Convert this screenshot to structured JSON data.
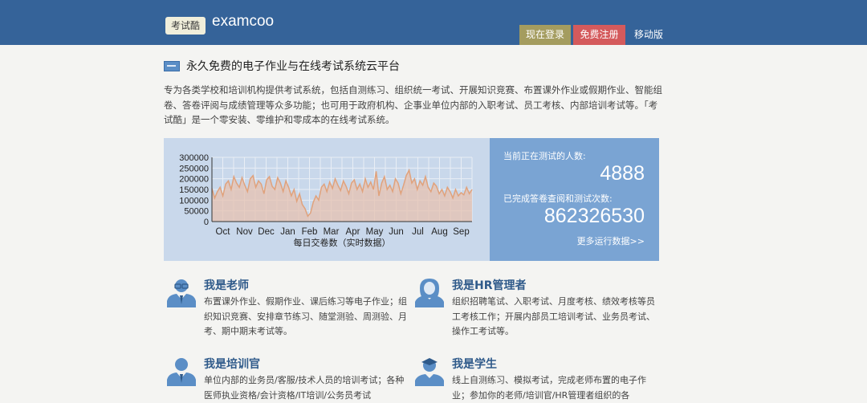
{
  "header": {
    "logo_text": "考试酷",
    "brand": "examcoo",
    "login": "现在登录",
    "register": "免费注册",
    "mobile": "移动版",
    "colors": {
      "bar": "#356399",
      "login": "#a49c5f",
      "register": "#d45a5c"
    }
  },
  "intro": {
    "tagline": "永久免费的电子作业与在线考试系统云平台",
    "text": "专为各类学校和培训机构提供考试系统，包括自测练习、组织统一考试、开展知识竞赛、布置课外作业或假期作业、智能组卷、答卷评阅与成绩管理等众多功能；也可用于政府机构、企事业单位内部的入职考试、员工考核、内部培训考试等。「考试酷」是一个零安装、零维护和零成本的在线考试系统。"
  },
  "stats": {
    "testing_label": "当前正在测试的人数:",
    "testing_value": "4888",
    "completed_label": "已完成答卷查阅和测试次数:",
    "completed_value": "862326530",
    "more_link": "更多运行数据>>"
  },
  "chart_data": {
    "type": "area",
    "title": "",
    "xlabel": "每日交卷数（实时数据）",
    "ylabel": "",
    "ylim": [
      0,
      300000
    ],
    "yticks": [
      0,
      50000,
      100000,
      150000,
      200000,
      250000,
      300000
    ],
    "categories": [
      "Oct",
      "Nov",
      "Dec",
      "Jan",
      "Feb",
      "Mar",
      "Apr",
      "May",
      "Jun",
      "Jul",
      "Aug",
      "Sep"
    ],
    "colors": {
      "line": "#e0a27c",
      "fill": "#e5c2b0"
    },
    "series": [
      {
        "values": [
          155000,
          110000,
          140000,
          160000,
          120000,
          175000,
          190000,
          150000,
          210000,
          180000,
          160000,
          205000,
          170000,
          140000,
          200000,
          215000,
          160000,
          190000,
          175000,
          130000,
          195000,
          210000,
          165000,
          150000,
          205000,
          180000,
          140000,
          190000,
          160000,
          120000,
          150000,
          95000,
          130000,
          80000,
          60000,
          25000,
          40000,
          90000,
          120000,
          100000,
          160000,
          175000,
          140000,
          185000,
          155000,
          200000,
          170000,
          145000,
          190000,
          165000,
          130000,
          180000,
          195000,
          150000,
          175000,
          140000,
          200000,
          160000,
          185000,
          150000,
          235000,
          120000,
          180000,
          210000,
          150000,
          170000,
          140000,
          200000,
          180000,
          130000,
          170000,
          215000,
          240000,
          180000,
          200000,
          150000,
          190000,
          170000,
          210000,
          160000,
          140000,
          180000,
          165000,
          130000,
          150000,
          120000,
          160000,
          140000,
          110000,
          150000,
          120000,
          135000,
          125000,
          160000,
          130000,
          150000
        ]
      }
    ]
  },
  "roles": [
    {
      "title": "我是老师",
      "desc": "布置课外作业、假期作业、课后练习等电子作业；组织知识竞赛、安排章节练习、随堂测验、周测验、月考、期中期末考试等。"
    },
    {
      "title": "我是HR管理者",
      "desc": "组织招聘笔试、入职考试、月度考核、绩效考核等员工考核工作；开展内部员工培训考试、业务员考试、操作工考试等。"
    },
    {
      "title": "我是培训官",
      "desc": "单位内部的业务员/客服/技术人员的培训考试；各种医师执业资格/会计资格/IT培训/公务员考试"
    },
    {
      "title": "我是学生",
      "desc": "线上自测练习、模拟考试，完成老师布置的电子作业；参加你的老师/培训官/HR管理者组织的各"
    }
  ]
}
